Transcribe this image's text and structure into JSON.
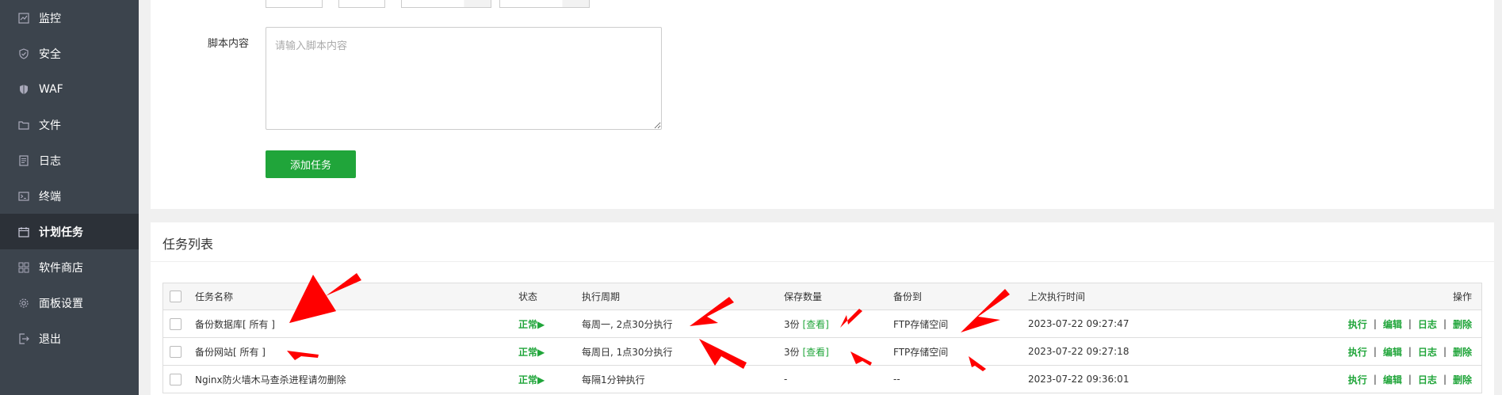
{
  "sidebar": {
    "items": [
      {
        "label": "监控",
        "icon": "monitor-icon"
      },
      {
        "label": "安全",
        "icon": "shield-icon"
      },
      {
        "label": "WAF",
        "icon": "waf-shield-icon"
      },
      {
        "label": "文件",
        "icon": "folder-icon"
      },
      {
        "label": "日志",
        "icon": "log-icon"
      },
      {
        "label": "终端",
        "icon": "terminal-icon"
      },
      {
        "label": "计划任务",
        "icon": "calendar-icon",
        "active": true
      },
      {
        "label": "软件商店",
        "icon": "grid-icon"
      },
      {
        "label": "面板设置",
        "icon": "gear-icon"
      },
      {
        "label": "退出",
        "icon": "logout-icon"
      }
    ]
  },
  "form": {
    "script_label": "脚本内容",
    "script_placeholder": "请输入脚本内容",
    "add_button": "添加任务"
  },
  "task_list": {
    "title": "任务列表",
    "headers": {
      "name": "任务名称",
      "status": "状态",
      "cycle": "执行周期",
      "retain": "保存数量",
      "backup_to": "备份到",
      "last_run": "上次执行时间",
      "ops": "操作"
    },
    "rows": [
      {
        "name": "备份数据库[ 所有 ]",
        "status": "正常▶",
        "cycle": "每周一, 2点30分执行",
        "retain_count": "3份",
        "retain_link": "[查看]",
        "backup_to": "FTP存储空间",
        "last_run": "2023-07-22 09:27:47"
      },
      {
        "name": "备份网站[ 所有 ]",
        "status": "正常▶",
        "cycle": "每周日, 1点30分执行",
        "retain_count": "3份",
        "retain_link": "[查看]",
        "backup_to": "FTP存储空间",
        "last_run": "2023-07-22 09:27:18"
      },
      {
        "name": "Nginx防火墙木马查杀进程请勿删除",
        "status": "正常▶",
        "cycle": "每隔1分钟执行",
        "retain_count": "-",
        "retain_link": "",
        "backup_to": "--",
        "last_run": "2023-07-22 09:36:01"
      }
    ],
    "actions": {
      "run": "执行",
      "edit": "编辑",
      "log": "日志",
      "delete": "删除",
      "separator": "|"
    }
  },
  "colors": {
    "accent": "#20a53a",
    "sidebar_bg": "#3c444d",
    "annotation": "#ff0000"
  }
}
